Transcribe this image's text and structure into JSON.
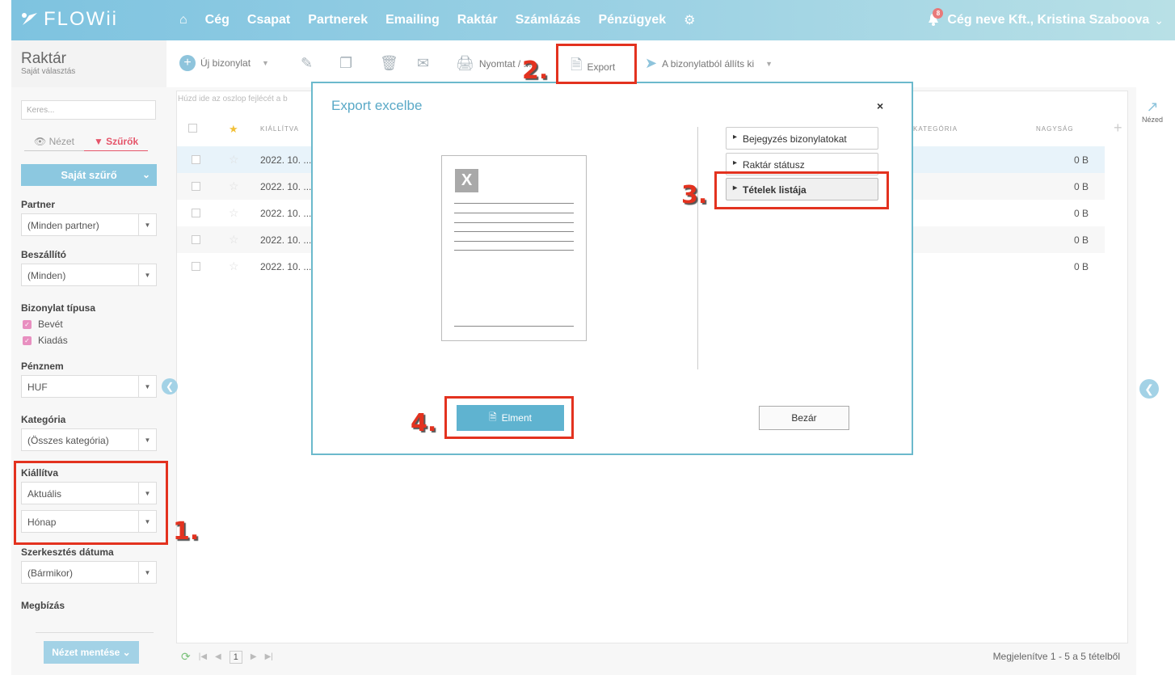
{
  "brand": {
    "logo": "FLOWii"
  },
  "nav": {
    "items": [
      "Cég",
      "Csapat",
      "Partnerek",
      "Emailing",
      "Raktár",
      "Számlázás",
      "Pénzügyek"
    ]
  },
  "user": {
    "label": "Cég neve Kft., Kristina Szaboova",
    "badge": "8"
  },
  "page": {
    "title": "Raktár",
    "subtitle": "Saját választás"
  },
  "toolbar": {
    "new_doc": "Új bizonylat",
    "print": "Nyomtat / ...",
    "export": "Export",
    "issue": "A bizonylatból állíts ki"
  },
  "sidebar": {
    "search_placeholder": "Keres...",
    "tab_view": "Nézet",
    "tab_filters": "Szűrők",
    "own_filter": "Saját szűrő",
    "partner_label": "Partner",
    "partner_value": "(Minden partner)",
    "supplier_label": "Beszállító",
    "supplier_value": "(Minden)",
    "doctype_label": "Bizonylat típusa",
    "doctype_in": "Bevét",
    "doctype_out": "Kiadás",
    "currency_label": "Pénznem",
    "currency_value": "HUF",
    "category_label": "Kategória",
    "category_value": "(Összes kategória)",
    "issued_label": "Kiállítva",
    "issued_value1": "Aktuális",
    "issued_value2": "Hónap",
    "edited_label": "Szerkesztés dátuma",
    "edited_value": "(Bármikor)",
    "assignment_label": "Megbízás",
    "save_view": "Nézet mentése"
  },
  "grid": {
    "group_hint": "Húzd ide az oszlop fejlécét a b",
    "col_issued": "KIÁLLÍTVA",
    "col_category": "KATEGÓRIA",
    "col_size": "NAGYSÁG",
    "rows": [
      {
        "date": "2022. 10. ...",
        "size": "0 B"
      },
      {
        "date": "2022. 10. ...",
        "size": "0 B"
      },
      {
        "date": "2022. 10. ...",
        "size": "0 B"
      },
      {
        "date": "2022. 10. ...",
        "size": "0 B"
      },
      {
        "date": "2022. 10. ...",
        "size": "0 B"
      }
    ],
    "page": "1",
    "count_text": "Megjelenítve 1 - 5 a 5 tételből",
    "ext_view": "Nézed"
  },
  "modal": {
    "title": "Export excelbe",
    "close": "×",
    "options": [
      "Bejegyzés bizonylatokat",
      "Raktár státusz",
      "Tételek listája"
    ],
    "save_btn": "Elment",
    "close_btn": "Bezár"
  },
  "annotations": [
    "1.",
    "2.",
    "3.",
    "4."
  ],
  "colors": {
    "accent": "#5fb3d0",
    "annotation": "#e3321f",
    "filter_active": "#e5556a"
  }
}
